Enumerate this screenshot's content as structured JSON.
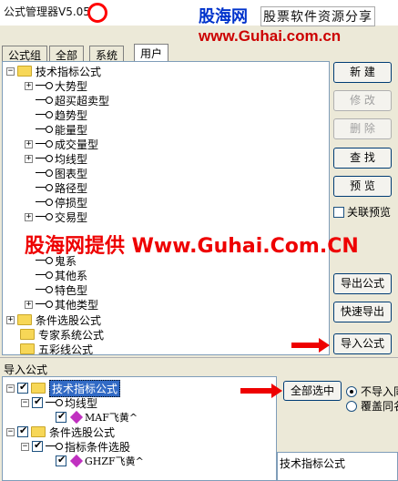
{
  "window": {
    "title": "公式管理器V5.05"
  },
  "logo": {
    "cn": "股海网",
    "sub": "股票软件资源分享",
    "url": "www.Guhai.com.cn"
  },
  "tabs": [
    {
      "label": "公式组"
    },
    {
      "label": "全部"
    },
    {
      "label": "系统"
    },
    {
      "label": "用户"
    }
  ],
  "tree": {
    "root": "技术指标公式",
    "children": [
      {
        "label": "大势型",
        "expandable": true
      },
      {
        "label": "超买超卖型",
        "expandable": false
      },
      {
        "label": "趋势型",
        "expandable": false
      },
      {
        "label": "能量型",
        "expandable": false
      },
      {
        "label": "成交量型",
        "expandable": true
      },
      {
        "label": "均线型",
        "expandable": true
      },
      {
        "label": "图表型",
        "expandable": false
      },
      {
        "label": "路径型",
        "expandable": false
      },
      {
        "label": "停损型",
        "expandable": false
      },
      {
        "label": "交易型",
        "expandable": true
      },
      {
        "label": "鬼系",
        "expandable": false
      },
      {
        "label": "其他系",
        "expandable": false
      },
      {
        "label": "特色型",
        "expandable": false
      },
      {
        "label": "其他类型",
        "expandable": true
      }
    ],
    "groups": [
      "条件选股公式",
      "专家系统公式",
      "五彩线公式"
    ]
  },
  "buttons": {
    "new": "新 建",
    "edit": "修 改",
    "delete": "删 除",
    "find": "查 找",
    "preview": "预 览",
    "related_preview": "关联预览",
    "export": "导出公式",
    "quick_export": "快速导出",
    "import": "导入公式"
  },
  "watermark": "股海网提供 Www.Guhai.Com.CN",
  "import": {
    "label": "导入公式",
    "tree": [
      {
        "label": "技术指标公式"
      },
      {
        "label": "均线型"
      },
      {
        "label": "MAF飞黄^"
      },
      {
        "label": "条件选股公式"
      },
      {
        "label": "指标条件选股"
      },
      {
        "label": "GHZF飞黄^"
      }
    ],
    "select_all": "全部选中",
    "radio_skip": "不导入同",
    "radio_overwrite": "覆盖同名",
    "selected_category": "技术指标公式"
  }
}
